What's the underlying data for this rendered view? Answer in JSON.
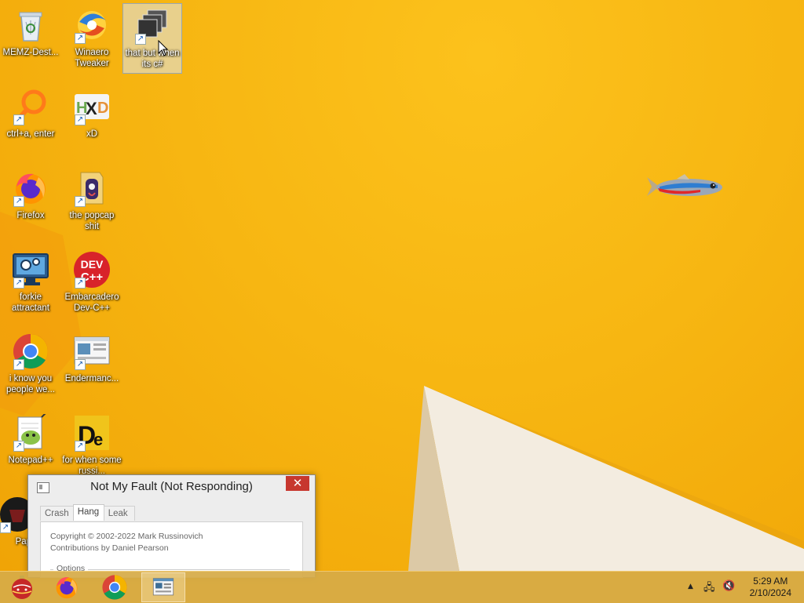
{
  "desktop": {
    "icons": [
      {
        "label": "MEMZ-Dest...",
        "icon": "recycle-bin-icon",
        "shortcut": false
      },
      {
        "label": "Winaero Tweaker",
        "icon": "winaero-icon",
        "shortcut": true
      },
      {
        "label": "that but when its c#",
        "icon": "stacked-windows-icon",
        "shortcut": true,
        "selected": true
      },
      {
        "label": "ctrl+a, enter",
        "icon": "magnifier-icon",
        "shortcut": true
      },
      {
        "label": "xD",
        "icon": "hxd-icon",
        "shortcut": true
      },
      {
        "label": "Firefox",
        "icon": "firefox-icon",
        "shortcut": true
      },
      {
        "label": "the popcap shit",
        "icon": "folder-icon",
        "shortcut": true
      },
      {
        "label": "forkie attractant",
        "icon": "monitor-gear-icon",
        "shortcut": true
      },
      {
        "label": "Embarcadero Dev-C++",
        "icon": "devcpp-icon",
        "shortcut": true
      },
      {
        "label": "i know you people we...",
        "icon": "chrome-icon",
        "shortcut": true
      },
      {
        "label": "Endermanc...",
        "icon": "window-app-icon",
        "shortcut": true
      },
      {
        "label": "Notepad++",
        "icon": "notepadpp-icon",
        "shortcut": true
      },
      {
        "label": "for when some russi...",
        "icon": "de-icon",
        "shortcut": true
      },
      {
        "label": "Papers",
        "icon": "papers-icon",
        "shortcut": true
      }
    ],
    "shortcut_glyph": "↗"
  },
  "window": {
    "title": "Not My Fault (Not Responding)",
    "close_glyph": "✕",
    "tabs": [
      "Crash",
      "Hang",
      "Leak"
    ],
    "active_tab": "Hang",
    "copyright": "Copyright © 2002-2022 Mark Russinovich",
    "contributions": "Contributions by Daniel Pearson",
    "options_label": "Options"
  },
  "taskbar": {
    "items": [
      {
        "name": "ornament-app",
        "icon": "ornament-icon"
      },
      {
        "name": "firefox",
        "icon": "firefox-icon"
      },
      {
        "name": "chrome",
        "icon": "chrome-icon"
      },
      {
        "name": "not-my-fault",
        "icon": "window-app-icon",
        "active": true
      }
    ],
    "tray": {
      "chevron_glyph": "▲",
      "network_glyph": "🖧",
      "volume_glyph": "🔇"
    },
    "clock": {
      "time": "5:29 AM",
      "date": "2/10/2024"
    }
  },
  "colors": {
    "wallpaper": "#f6b40e",
    "close_button": "#c7372f",
    "taskbar": "#d6aa46"
  }
}
